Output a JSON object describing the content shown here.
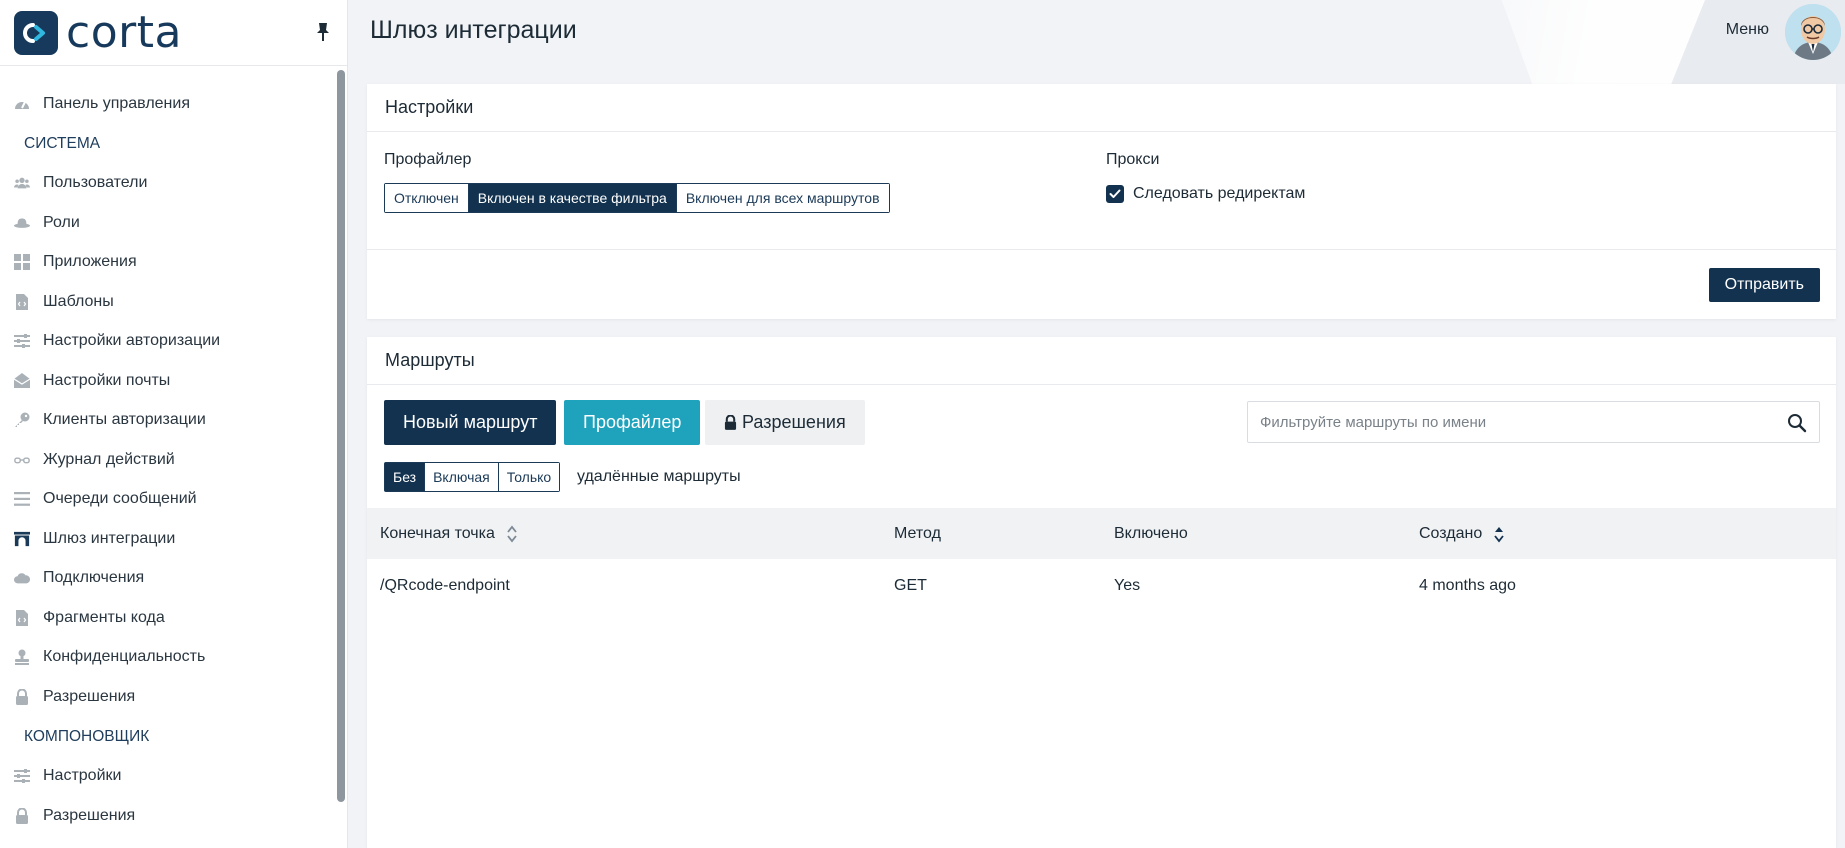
{
  "brand": {
    "name": "corta"
  },
  "sidebar": {
    "items": [
      {
        "label": "Панель управления",
        "icon": "dashboard-icon"
      },
      {
        "section": "СИСТЕМА"
      },
      {
        "label": "Пользователи",
        "icon": "users-icon"
      },
      {
        "label": "Роли",
        "icon": "hat-icon"
      },
      {
        "label": "Приложения",
        "icon": "grid-icon"
      },
      {
        "label": "Шаблоны",
        "icon": "file-code-icon"
      },
      {
        "label": "Настройки авторизации",
        "icon": "sliders-icon"
      },
      {
        "label": "Настройки почты",
        "icon": "envelope-open-icon"
      },
      {
        "label": "Клиенты авторизации",
        "icon": "key-icon"
      },
      {
        "label": "Журнал действий",
        "icon": "glasses-icon"
      },
      {
        "label": "Очереди сообщений",
        "icon": "list-icon"
      },
      {
        "label": "Шлюз интеграции",
        "icon": "archway-icon"
      },
      {
        "label": "Подключения",
        "icon": "cloud-icon"
      },
      {
        "label": "Фрагменты кода",
        "icon": "file-code-icon"
      },
      {
        "label": "Конфиденциальность",
        "icon": "stamp-icon"
      },
      {
        "label": "Разрешения",
        "icon": "lock-icon"
      },
      {
        "section": "КОМПОНОВЩИК"
      },
      {
        "label": "Настройки",
        "icon": "sliders-icon"
      },
      {
        "label": "Разрешения",
        "icon": "lock-icon"
      }
    ]
  },
  "header": {
    "title": "Шлюз интеграции",
    "menu_label": "Меню"
  },
  "settings": {
    "title": "Настройки",
    "profiler_label": "Профайлер",
    "profiler_options": [
      "Отключен",
      "Включен в качестве фильтра",
      "Включен для всех маршрутов"
    ],
    "profiler_selected": "Включен в качестве фильтра",
    "proxy_label": "Прокси",
    "follow_redirects_label": "Следовать редиректам",
    "follow_redirects_checked": true,
    "submit_label": "Отправить"
  },
  "routes": {
    "title": "Маршруты",
    "new_route_label": "Новый маршрут",
    "profiler_label": "Профайлер",
    "permissions_label": "Разрешения",
    "search_placeholder": "Фильтруйте маршруты по имени",
    "deleted_options": [
      "Без",
      "Включая",
      "Только"
    ],
    "deleted_selected": "Без",
    "deleted_label": "удалённые маршруты",
    "columns": [
      "Конечная точка",
      "Метод",
      "Включено",
      "Создано"
    ],
    "rows": [
      {
        "endpoint": "/QRcode-endpoint",
        "method": "GET",
        "enabled": "Yes",
        "created": "4 months ago"
      }
    ]
  },
  "colors": {
    "primary": "#12324f",
    "accent": "#1fa3bd",
    "brand": "#173a5c"
  }
}
